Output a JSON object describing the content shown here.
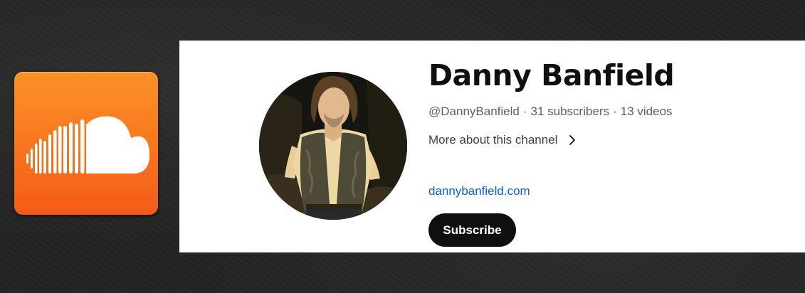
{
  "app_logo": {
    "icon": "soundcloud-cloud-icon",
    "colors": {
      "top": "#fb9127",
      "bottom": "#f35b18",
      "glyph": "#ffffff"
    }
  },
  "channel": {
    "name": "Danny Banfield",
    "handle": "@DannyBanfield",
    "separator": "·",
    "subscribers": "31 subscribers",
    "videos": "13 videos",
    "more_about_label": "More about this channel",
    "more_about_icon": "chevron-right-icon",
    "link_text": "dannybanfield.com",
    "subscribe_label": "Subscribe",
    "avatar_icon": "channel-avatar-photo",
    "colors": {
      "card_background": "#ffffff",
      "link": "#065fd4",
      "subscribe_background": "#0f0f0f",
      "subscribe_text": "#ffffff"
    }
  },
  "page": {
    "background": "#242424"
  }
}
